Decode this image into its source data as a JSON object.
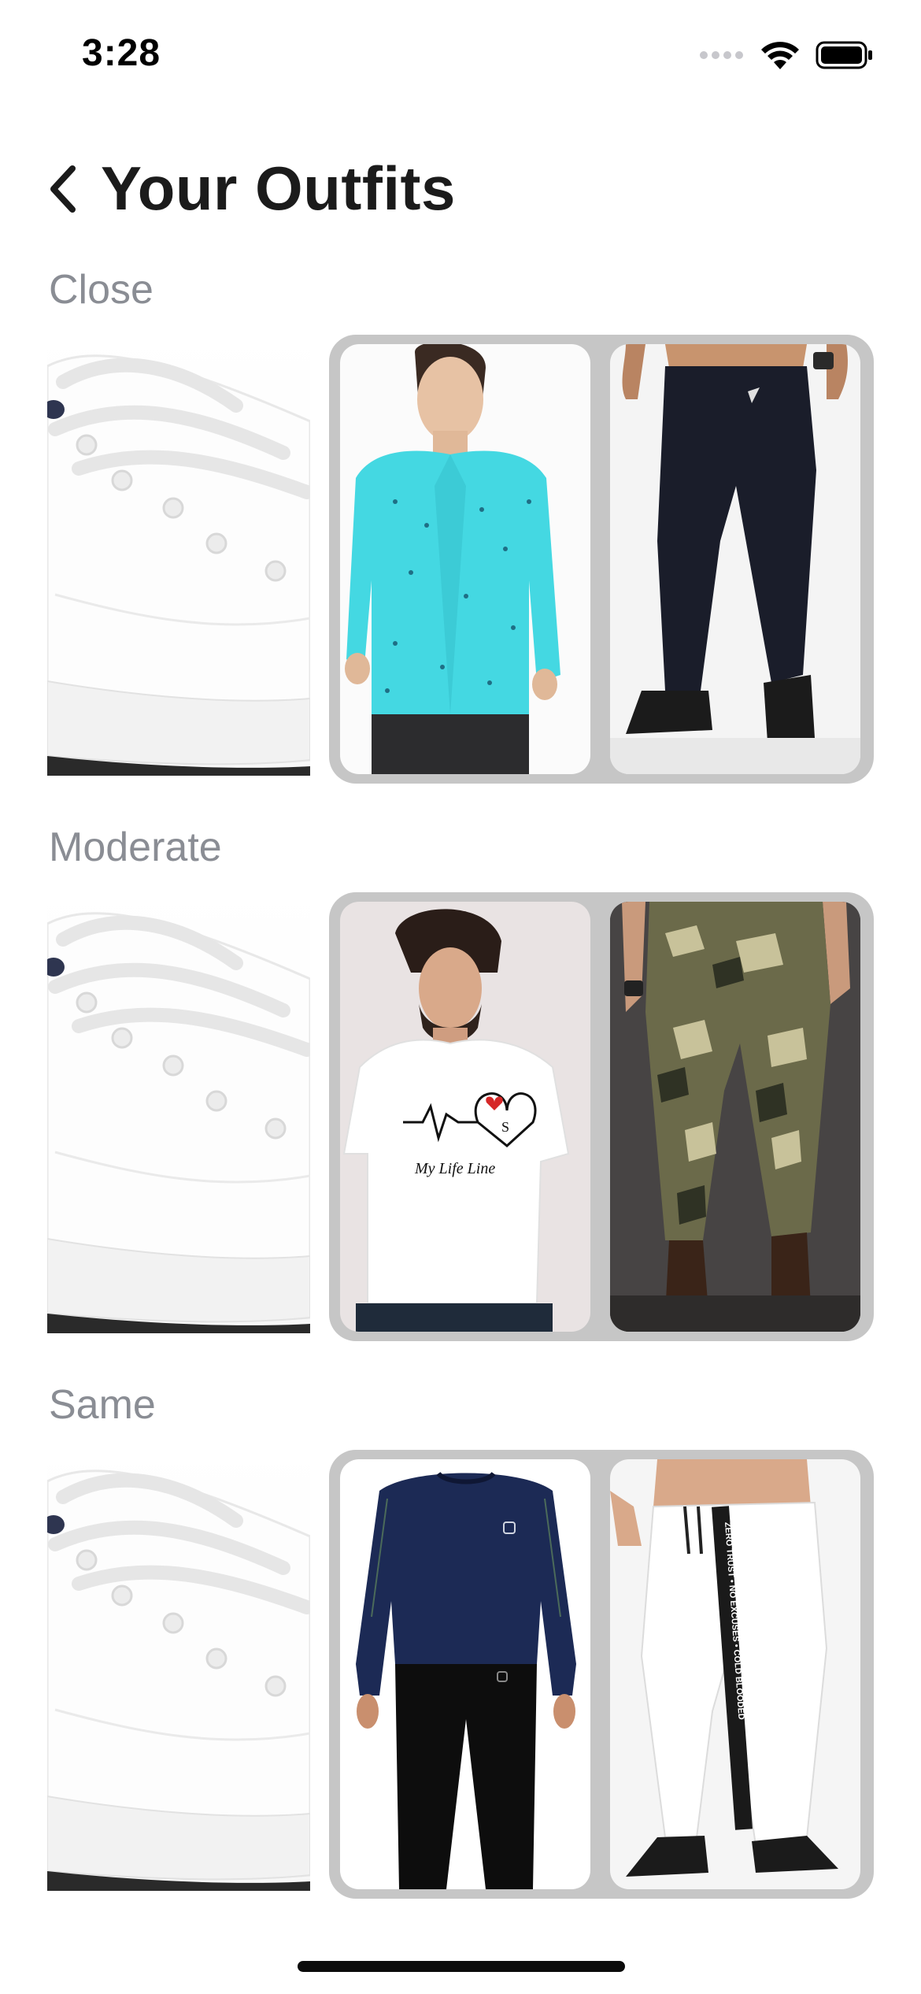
{
  "status_bar": {
    "time": "3:28",
    "icons": [
      "signal-dots-icon",
      "wifi-icon",
      "battery-icon"
    ]
  },
  "header": {
    "back_icon": "chevron-left-icon",
    "title": "Your Outfits"
  },
  "sections": [
    {
      "label": "Close",
      "shoe": "white-sneaker",
      "top": "turquoise-printed-shirt",
      "bottom": "black-joggers"
    },
    {
      "label": "Moderate",
      "shoe": "white-sneaker",
      "top": "white-graphic-tshirt",
      "top_print": "My Life Line",
      "top_print_letter": "S",
      "bottom": "camo-cargo-pants"
    },
    {
      "label": "Same",
      "shoe": "white-sneaker",
      "top": "navy-long-sleeve-compression-top",
      "bottom": "white-track-pants",
      "bottom_stripe_text": "ZERO TRUST • NO EXCUSES • COLD BLOODED"
    }
  ],
  "colors": {
    "background": "#ffffff",
    "title": "#1b1b1b",
    "section_label": "#8a8d94",
    "card_frame": "#c6c6c6"
  }
}
